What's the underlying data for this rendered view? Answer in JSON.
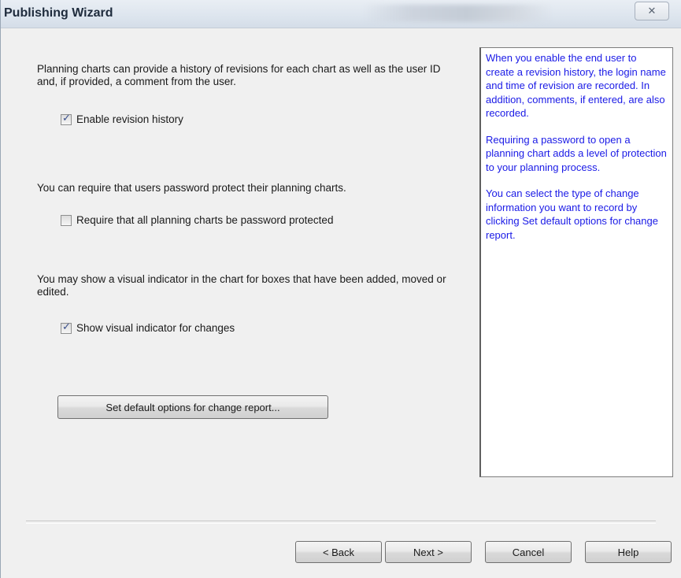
{
  "window": {
    "title": "Publishing Wizard",
    "close_glyph": "✕"
  },
  "sections": {
    "revision": {
      "description": "Planning charts can provide a history of revisions for each chart as well as the user ID and, if provided, a comment from the user.",
      "checkbox_label": "Enable revision history",
      "checked": true
    },
    "password": {
      "description": "You can require that users password protect their planning charts.",
      "checkbox_label": "Require that all planning charts be password protected",
      "checked": false
    },
    "indicator": {
      "description": "You may show a visual indicator in the chart for boxes that have been added, moved or edited.",
      "checkbox_label": "Show visual indicator for changes",
      "checked": true
    }
  },
  "change_report_button": "Set default options for change report...",
  "help_panel": {
    "paragraphs": [
      "When you enable the end user to create a revision history, the login name and time of revision are recorded. In addition, comments, if entered, are also recorded.",
      "Requiring a password to open a planning chart adds a level of protection to your planning process.",
      "You can select the type of change information you want to record by clicking Set default options for change report."
    ],
    "text_color": "#1a1ae6"
  },
  "footer_buttons": {
    "back": "< Back",
    "next": "Next >",
    "cancel": "Cancel",
    "help": "Help"
  }
}
